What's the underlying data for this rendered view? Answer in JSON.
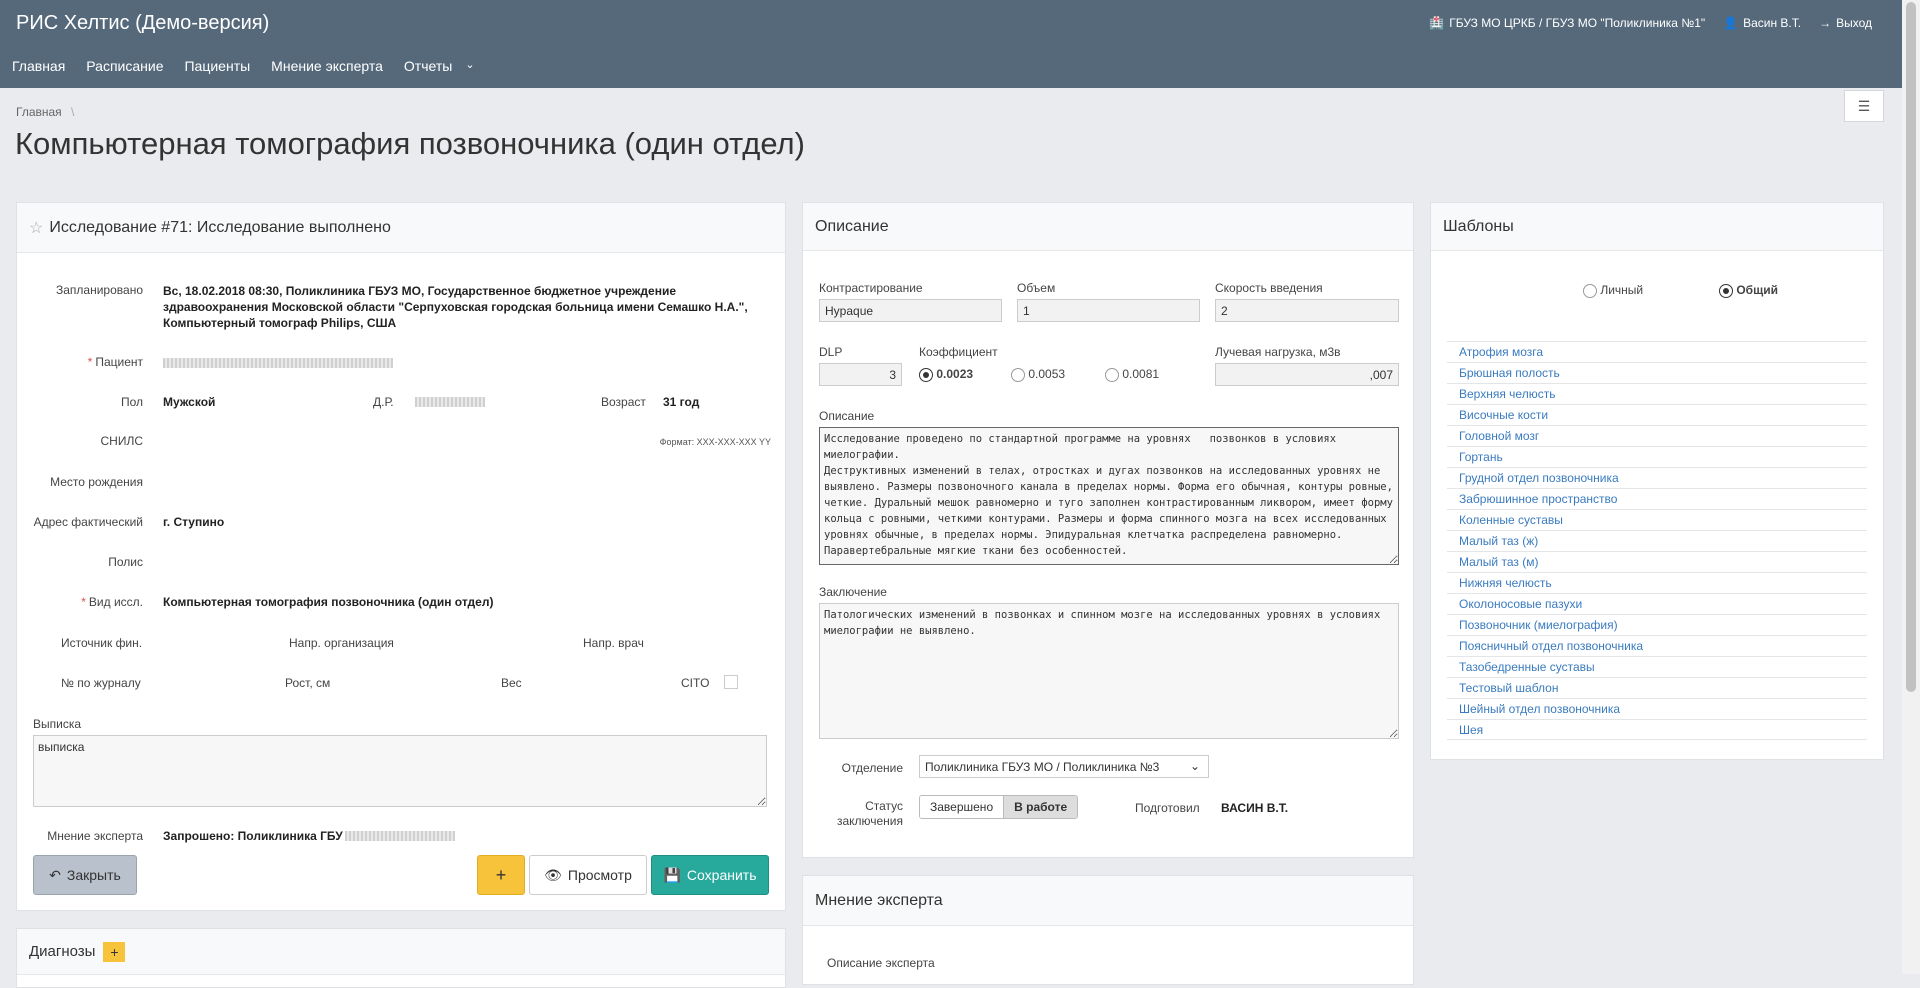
{
  "header": {
    "app_title": "РИС Хелтис (Демо-версия)",
    "org": "ГБУЗ МО ЦРКБ / ГБУЗ МО \"Поликлиника №1\"",
    "user": "Васин В.Т.",
    "logout": "Выход",
    "nav": [
      "Главная",
      "Расписание",
      "Пациенты",
      "Мнение эксперта",
      "Отчеты"
    ]
  },
  "breadcrumb": {
    "home": "Главная",
    "separator": "\\"
  },
  "page_title": "Компьютерная томография позвоночника (один отдел)",
  "study": {
    "title": "Исследование #71: Исследование выполнено",
    "planned_label": "Запланировано",
    "planned_value": "Вс, 18.02.2018 08:30, Поликлиника ГБУЗ МО, Государственное бюджетное учреждение здравоохранения Московской области \"Серпуховская городская больница имени Семашко Н.А.\", Компьютерный томограф Philips, США",
    "patient_label": "Пациент",
    "sex_label": "Пол",
    "sex_value": "Мужской",
    "dob_label": "Д.Р.",
    "age_label": "Возраст",
    "age_value": "31 год",
    "snils_label": "СНИЛС",
    "snils_format": "Формат: XXX-XXX-XXX YY",
    "birthplace_label": "Место рождения",
    "address_label": "Адрес фактический",
    "address_value": "г. Ступино",
    "policy_label": "Полис",
    "type_label": "Вид иссл.",
    "type_value": "Компьютерная томография позвоночника (один отдел)",
    "source_label": "Источник фин.",
    "ref_org_label": "Напр. организация",
    "ref_doctor_label": "Напр. врач",
    "journal_label": "№ по журналу",
    "height_label": "Рост, см",
    "weight_label": "Вес",
    "cito_label": "CITO",
    "extract_label": "Выписка",
    "extract_value": "выписка",
    "expert_label": "Мнение эксперта",
    "expert_value": "Запрошено: Поликлиника ГБУ",
    "close_btn": "Закрыть",
    "add_btn": "+",
    "preview_btn": "Просмотр",
    "save_btn": "Сохранить"
  },
  "diagnoses": {
    "title": "Диагнозы",
    "add": "+"
  },
  "description": {
    "title": "Описание",
    "contrast_label": "Контрастирование",
    "contrast_value": "Hypaque",
    "volume_label": "Объем",
    "volume_value": "1",
    "speed_label": "Скорость введения",
    "speed_value": "2",
    "dlp_label": "DLP",
    "dlp_value": "3",
    "coef_label": "Коэффициент",
    "coef_options": [
      "0.0023",
      "0.0053",
      "0.0081"
    ],
    "coef_selected": "0.0023",
    "dose_label": "Лучевая нагрузка, м3в",
    "dose_value": ",007",
    "desc_label": "Описание",
    "desc_text": "Исследование проведено по стандартной программе на уровнях   позвонков в условиях миелографии.\nДеструктивных изменений в телах, отростках и дугах позвонков на исследованных уровнях не выявлено. Размеры позвоночного канала в пределах нормы. Форма его обычная, контуры ровные, четкие. Дуральный мешок равномерно и туго заполнен контрастированным ликвором, имеет форму кольца с ровными, четкими контурами. Размеры и форма спинного мозга на всех исследованных уровнях обычные, в пределах нормы. Эпидуральная клетчатка распределена равномерно. Паравертебральные мягкие ткани без особенностей.",
    "conclusion_label": "Заключение",
    "conclusion_text": "Патологических изменений в позвонках и спинном мозге на исследованных уровнях в условиях миелографии не выявлено.",
    "dept_label": "Отделение",
    "dept_value": "Поликлиника ГБУЗ МО / Поликлиника №3",
    "status_label": "Статус заключения",
    "status_options": [
      "Завершено",
      "В работе"
    ],
    "status_selected": "В работе",
    "prepared_label": "Подготовил",
    "prepared_value": "ВАСИН В.Т."
  },
  "expert_opinion": {
    "title": "Мнение эксперта",
    "desc_label": "Описание эксперта"
  },
  "templates": {
    "title": "Шаблоны",
    "scope_options": [
      "Личный",
      "Общий"
    ],
    "scope_selected": "Общий",
    "items": [
      "Атрофия мозга",
      "Брюшная полость",
      "Верхняя челюсть",
      "Височные кости",
      "Головной мозг",
      "Гортань",
      "Грудной отдел позвоночника",
      "Забрюшинное пространство",
      "Коленные суставы",
      "Малый таз (ж)",
      "Малый таз (м)",
      "Нижняя челюсть",
      "Околоносовые пазухи",
      "Позвоночник (миелография)",
      "Поясничный отдел позвоночника",
      "Тазобедренные суставы",
      "Тестовый шаблон",
      "Шейный отдел позвоночника",
      "Шея"
    ]
  },
  "colors": {
    "topbar": "#56697b",
    "save": "#27a99c",
    "add": "#f6c33b",
    "link": "#3a7bbf"
  }
}
